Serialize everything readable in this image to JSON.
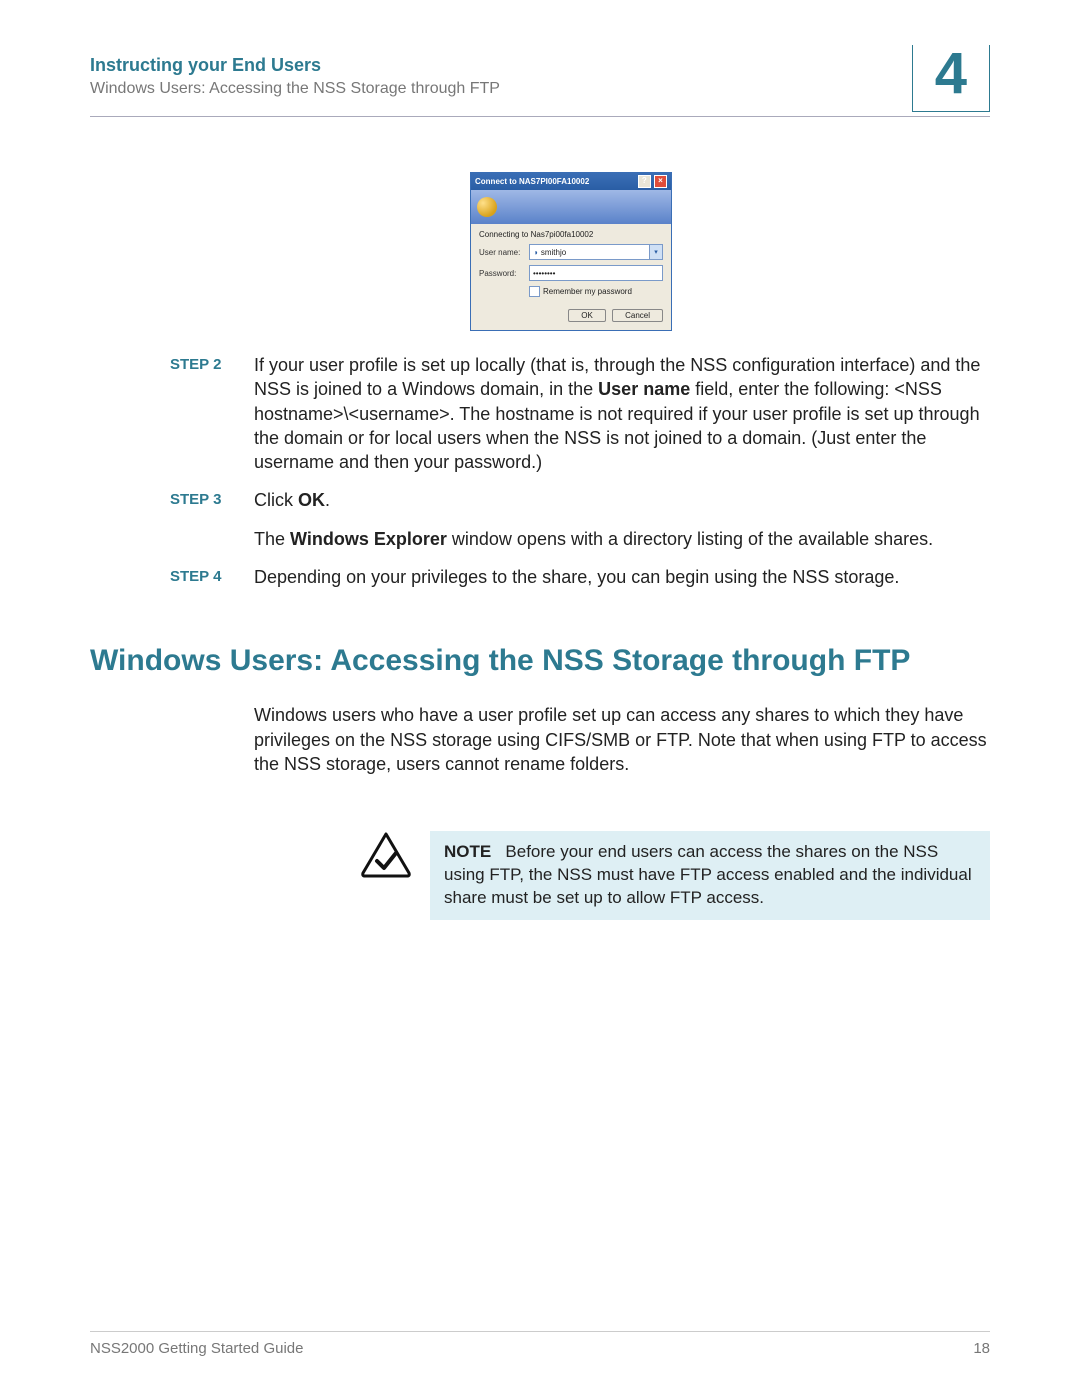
{
  "header": {
    "title": "Instructing your End Users",
    "subtitle": "Windows Users: Accessing the NSS Storage through FTP",
    "chapter": "4"
  },
  "dialog": {
    "title": "Connect to NAS7PI00FA10002",
    "connecting": "Connecting to Nas7pi00fa10002",
    "username_label": "User name:",
    "username_value": "smithjo",
    "password_label": "Password:",
    "password_value": "••••••••",
    "remember": "Remember my password",
    "ok": "OK",
    "cancel": "Cancel"
  },
  "steps": {
    "s2": {
      "label": "STEP 2",
      "text_a": "If your user profile is set up locally (that is, through the NSS configuration interface) and the NSS is joined to a Windows domain, in the ",
      "bold_a": "User name",
      "text_b": " field, enter the following: <NSS hostname>\\<username>. The hostname is not required if your user profile is set up through the domain or for local users when the NSS is not joined to a domain. (Just enter the username and then your password.)"
    },
    "s3": {
      "label": "STEP 3",
      "text_a": "Click ",
      "bold_a": "OK",
      "text_b": ".",
      "para2_a": "The ",
      "para2_bold": "Windows Explorer",
      "para2_b": " window opens with a directory listing of the available shares."
    },
    "s4": {
      "label": "STEP 4",
      "text": "Depending on your privileges to the share, you can begin using the NSS storage."
    }
  },
  "section": {
    "heading": "Windows Users: Accessing the NSS Storage through FTP",
    "intro": "Windows users who have a user profile set up can access any shares to which they have privileges on the NSS storage using CIFS/SMB or FTP. Note that when using FTP to access the NSS storage, users cannot rename folders."
  },
  "note": {
    "label": "NOTE",
    "text": "Before your end users can access the shares on the NSS using FTP, the NSS must have FTP access enabled and the individual share must be set up to allow FTP access."
  },
  "footer": {
    "guide": "NSS2000 Getting Started Guide",
    "page": "18"
  }
}
